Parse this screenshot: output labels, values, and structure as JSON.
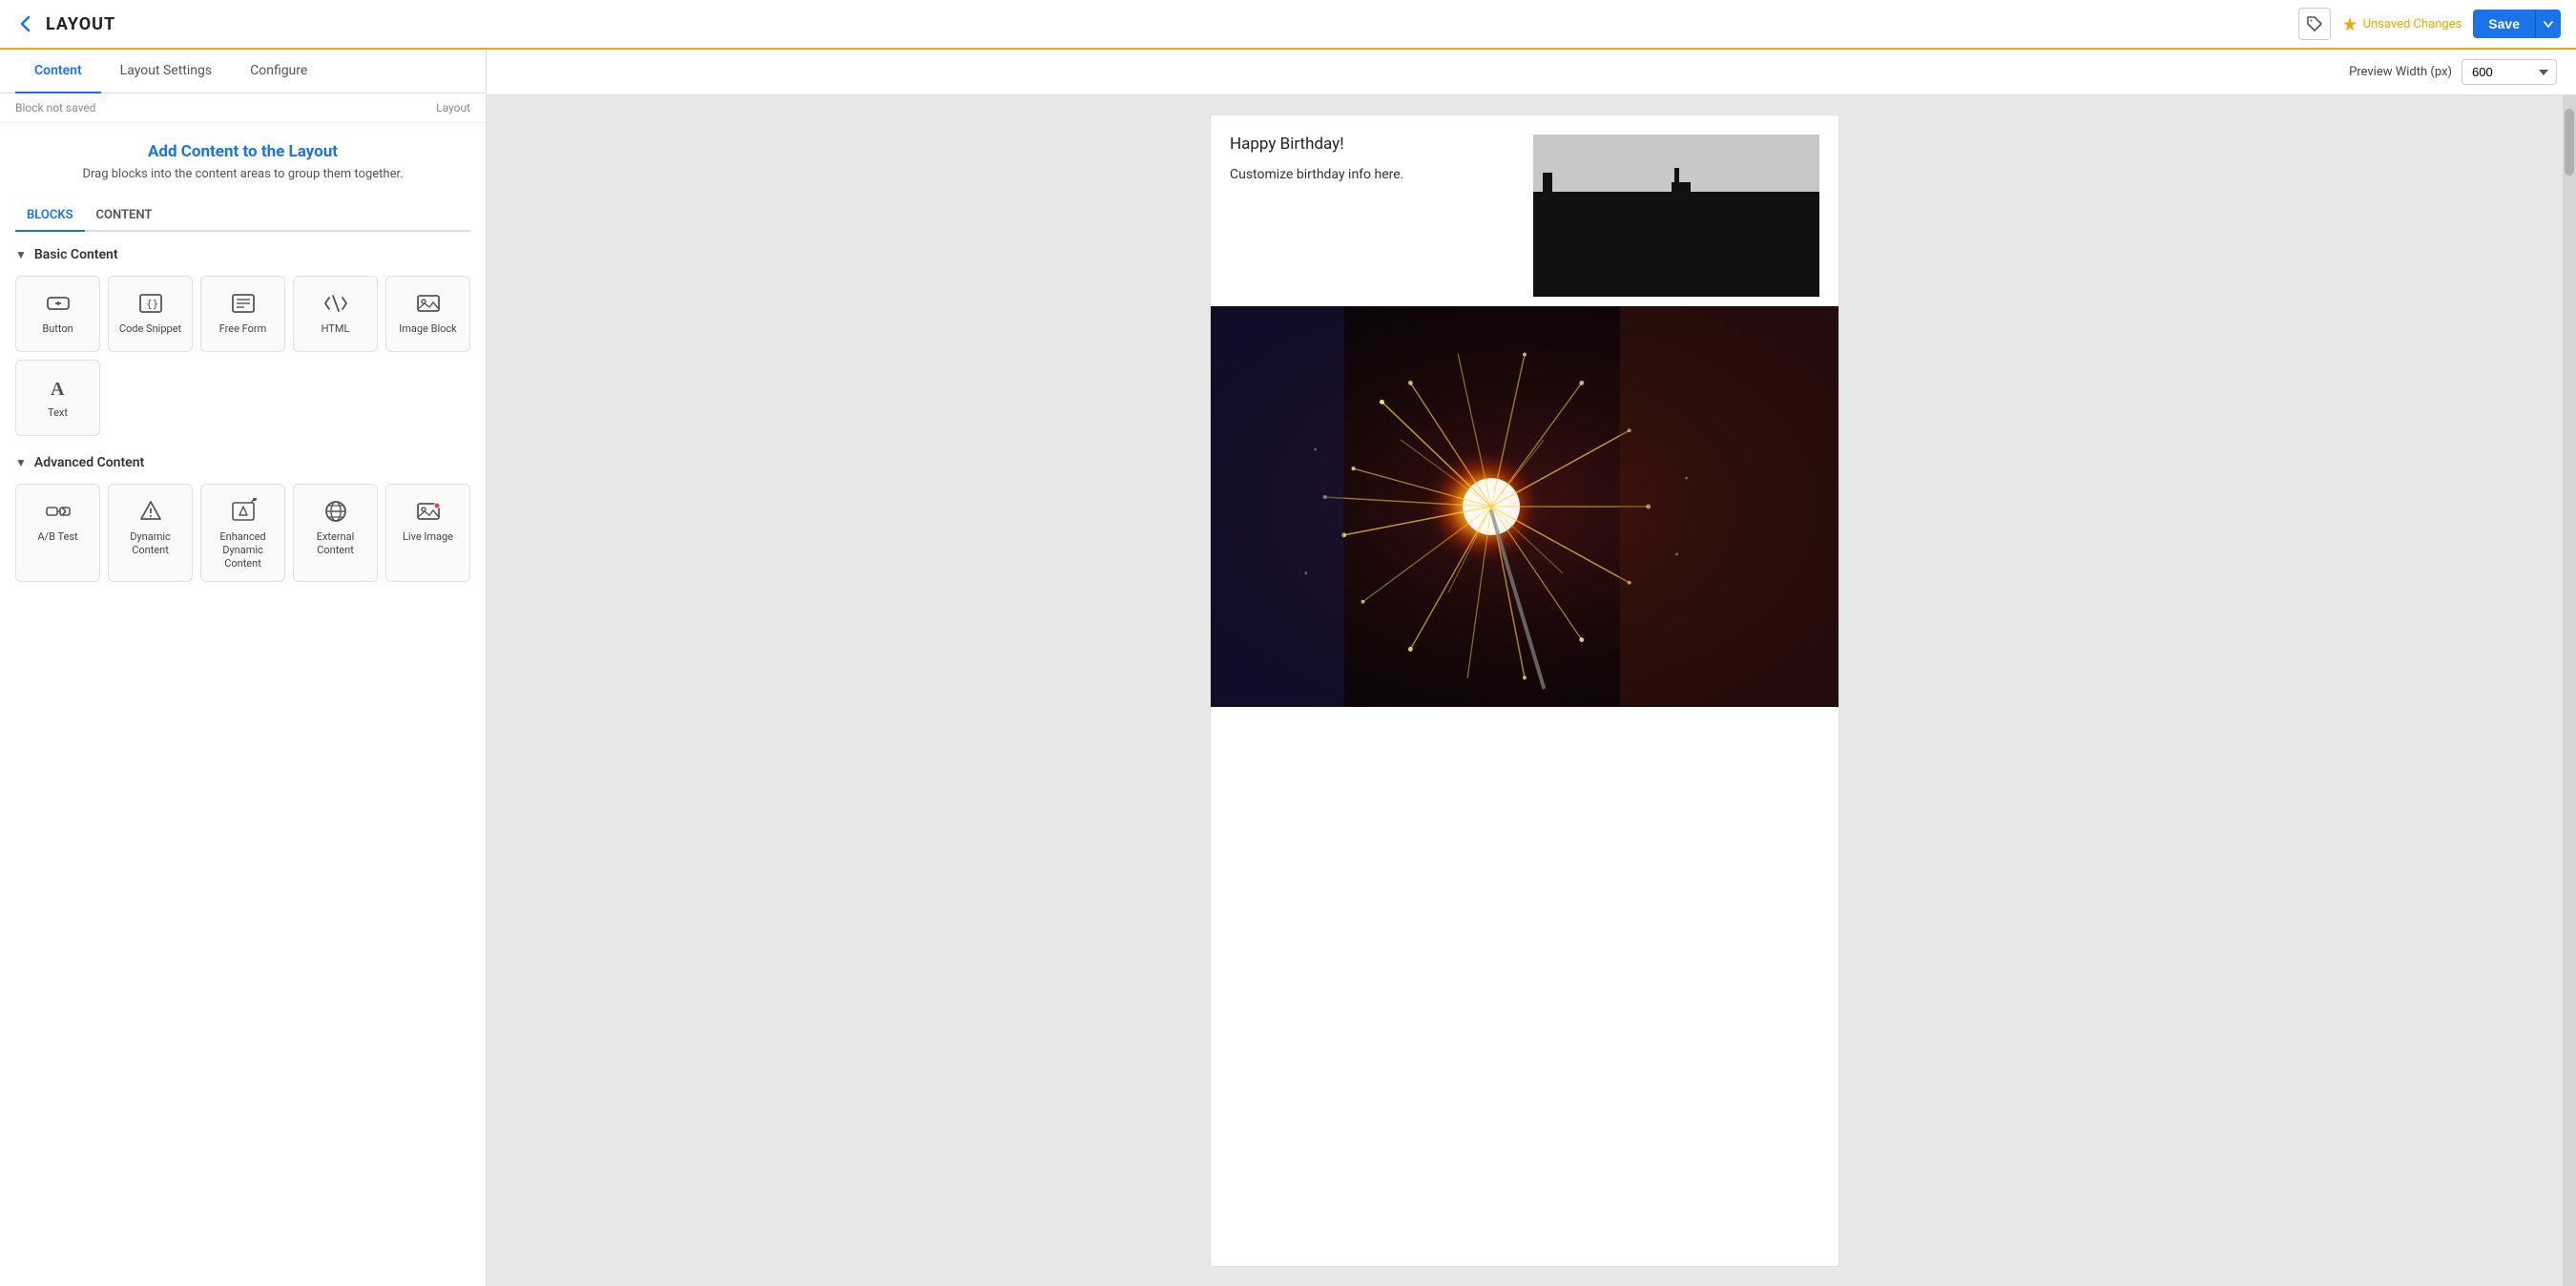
{
  "topbar": {
    "title": "LAYOUT",
    "back_label": "←",
    "unsaved_changes_label": "Unsaved Changes",
    "save_label": "Save",
    "save_dropdown_label": "▾"
  },
  "tabs": [
    {
      "id": "content",
      "label": "Content",
      "active": true
    },
    {
      "id": "layout-settings",
      "label": "Layout Settings",
      "active": false
    },
    {
      "id": "configure",
      "label": "Configure",
      "active": false
    }
  ],
  "breadcrumb": {
    "block_not_saved": "Block not saved",
    "layout": "Layout"
  },
  "panel": {
    "heading": "Add Content to the Layout",
    "subheading": "Drag blocks into the content areas to group them together."
  },
  "sub_tabs": [
    {
      "id": "blocks",
      "label": "BLOCKS",
      "active": true
    },
    {
      "id": "content",
      "label": "CONTENT",
      "active": false
    }
  ],
  "basic_content": {
    "section_label": "Basic Content",
    "items": [
      {
        "id": "button",
        "label": "Button",
        "icon": "button"
      },
      {
        "id": "code-snippet",
        "label": "Code Snippet",
        "icon": "code-snippet"
      },
      {
        "id": "free-form",
        "label": "Free Form",
        "icon": "free-form"
      },
      {
        "id": "html",
        "label": "HTML",
        "icon": "html"
      },
      {
        "id": "image-block",
        "label": "Image Block",
        "icon": "image-block"
      },
      {
        "id": "text",
        "label": "Text",
        "icon": "text"
      }
    ]
  },
  "advanced_content": {
    "section_label": "Advanced Content",
    "items": [
      {
        "id": "ab-test",
        "label": "A/B Test",
        "icon": "ab-test"
      },
      {
        "id": "dynamic-content",
        "label": "Dynamic Content",
        "icon": "dynamic-content"
      },
      {
        "id": "enhanced-dynamic-content",
        "label": "Enhanced Dynamic Content",
        "icon": "enhanced-dynamic"
      },
      {
        "id": "external-content",
        "label": "External Content",
        "icon": "external-content"
      },
      {
        "id": "live-image",
        "label": "Live Image",
        "icon": "live-image"
      }
    ]
  },
  "preview": {
    "label": "Preview Width (px)",
    "width_value": "600",
    "birthday_title": "Happy Birthday!",
    "birthday_subtitle": "Customize birthday info here."
  }
}
